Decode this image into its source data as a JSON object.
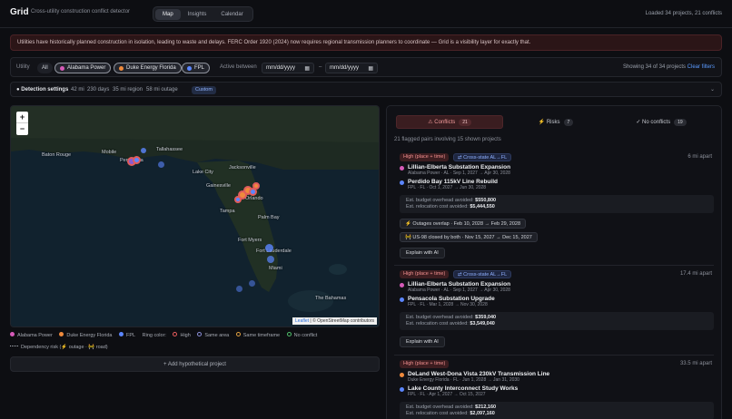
{
  "header": {
    "brand": "Grid",
    "subtitle": "Cross-utility construction conflict detector",
    "tabs": [
      "Map",
      "Insights",
      "Calendar"
    ],
    "status": "Loaded 34 projects, 21 conflicts"
  },
  "banner": "Utilities have historically planned construction in isolation, leading to waste and delays. FERC Order 1920 (2024) now requires regional transmission planners to coordinate — Grid is a visibility layer for exactly that.",
  "filters": {
    "utility_label": "Utility",
    "all_label": "All",
    "utilities": [
      {
        "name": "Alabama Power",
        "color": "#d65ab8"
      },
      {
        "name": "Duke Energy Florida",
        "color": "#ef8a3c"
      },
      {
        "name": "FPL",
        "color": "#5b86ff"
      }
    ],
    "active_between_label": "Active between",
    "date_from_placeholder": "mm/dd/yyyy",
    "date_to_placeholder": "mm/dd/yyyy",
    "date_sep": "–",
    "showing": "Showing 34 of 34 projects",
    "clear": "Clear filters"
  },
  "detection": {
    "title": "Detection settings",
    "distance": "42 mi",
    "days": "230 days",
    "region": "35 mi region",
    "outage": "58 mi outage",
    "mode": "Custom"
  },
  "map": {
    "zoom_in": "+",
    "zoom_out": "−",
    "attribution_leaflet": "Leaflet",
    "attribution_rest": " | © OpenStreetMap contributors",
    "cities": [
      "Baton Rouge",
      "Tallahassee",
      "Jacksonville",
      "Lake City",
      "Gainesville",
      "Orlando",
      "Tampa",
      "Fort Myers",
      "Miami",
      "Fort Lauderdale",
      "The Bahamas",
      "Palm Bay",
      "Pensacola",
      "Mobile"
    ]
  },
  "legend": {
    "utilities": [
      "Alabama Power",
      "Duke Energy Florida",
      "FPL"
    ],
    "ring_label": "Ring color:",
    "rings": [
      {
        "label": "High",
        "color": "#e85c5c"
      },
      {
        "label": "Same area",
        "color": "#8b8fd9"
      },
      {
        "label": "Same timeframe",
        "color": "#e0a040"
      },
      {
        "label": "No conflict",
        "color": "#4fbf6a"
      }
    ],
    "dependency": "Dependency risk (⚡ outage · 🚧 road)",
    "add_button": "+ Add hypothetical project"
  },
  "panel": {
    "tabs": [
      {
        "label": "⚠ Conflicts",
        "count": "21"
      },
      {
        "label": "⚡ Risks",
        "count": "7"
      },
      {
        "label": "✓ No conflicts",
        "count": "19"
      }
    ],
    "summary": "21 flagged pairs involving 15 shown projects",
    "conflicts": [
      {
        "severity": "High (place + time)",
        "cross": "⇄ Cross-state AL→FL",
        "distance": "6 mi apart",
        "a": {
          "name": "Lillian-Elberta Substation Expansion",
          "meta": "Alabama Power · AL · Sep 1, 2027 → Apr 30, 2028",
          "color": "#d65ab8"
        },
        "b": {
          "name": "Perdido Bay 115kV Line Rebuild",
          "meta": "FPL · FL · Oct 1, 2027 → Jun 30, 2028",
          "color": "#5b86ff"
        },
        "budget": "Est. budget overhead avoided: ",
        "budget_val": "$550,800",
        "reloc": "Est. relocation cost avoided: ",
        "reloc_val": "$5,444,550",
        "pills": [
          "⚡ Outages overlap · Feb 10, 2028 → Feb 29, 2028",
          "🚧 US-98 closed by both · Nov 15, 2027 → Dec 15, 2027"
        ],
        "explain": "Explain with AI"
      },
      {
        "severity": "High (place + time)",
        "cross": "⇄ Cross-state AL→FL",
        "distance": "17.4 mi apart",
        "a": {
          "name": "Lillian-Elberta Substation Expansion",
          "meta": "Alabama Power · AL · Sep 1, 2027 → Apr 30, 2028",
          "color": "#d65ab8"
        },
        "b": {
          "name": "Pensacola Substation Upgrade",
          "meta": "FPL · FL · Mar 1, 2028 → Nov 30, 2028",
          "color": "#5b86ff"
        },
        "budget": "Est. budget overhead avoided: ",
        "budget_val": "$359,040",
        "reloc": "Est. relocation cost avoided: ",
        "reloc_val": "$3,549,040",
        "explain": "Explain with AI"
      },
      {
        "severity": "High (place + time)",
        "distance": "33.5 mi apart",
        "a": {
          "name": "DeLand West-Dona Vista 230kV Transmission Line",
          "meta": "Duke Energy Florida · FL · Jun 1, 2028 → Jan 31, 2030",
          "color": "#ef8a3c"
        },
        "b": {
          "name": "Lake County Interconnect Study Works",
          "meta": "FPL · FL · Apr 1, 2027 → Oct 15, 2027",
          "color": "#5b86ff"
        },
        "budget": "Est. budget overhead avoided: ",
        "budget_val": "$212,160",
        "reloc": "Est. relocation cost avoided: ",
        "reloc_val": "$2,097,160"
      }
    ]
  }
}
